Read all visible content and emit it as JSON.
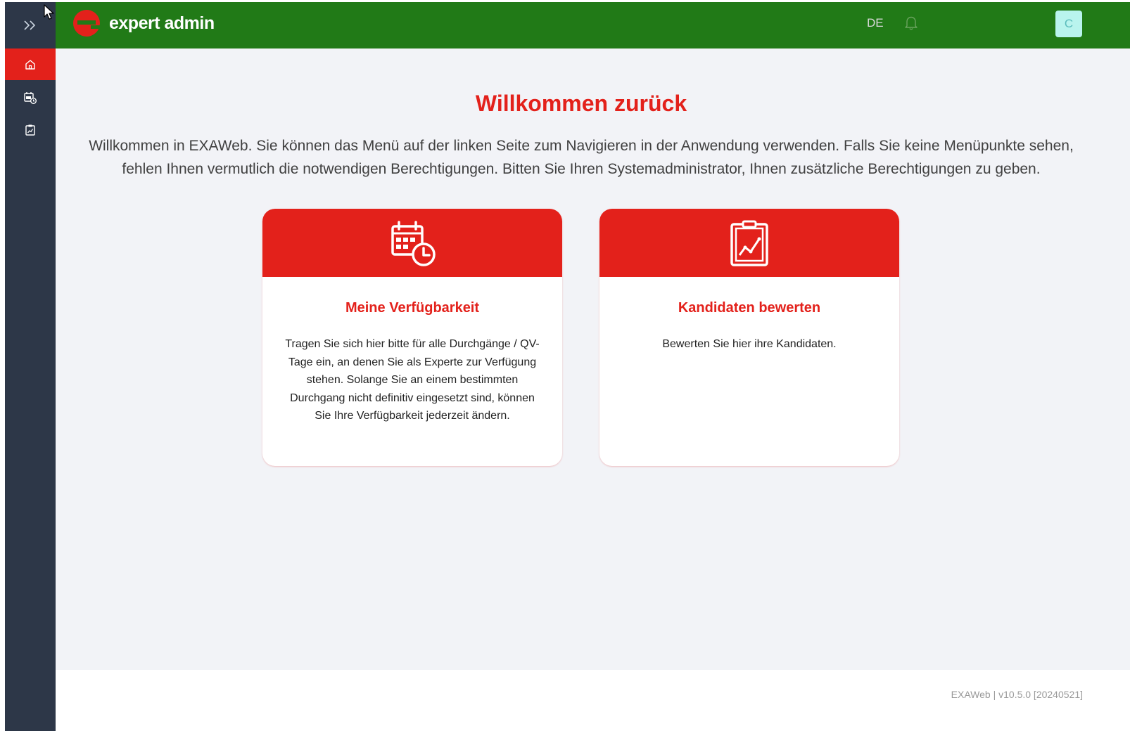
{
  "brand": {
    "name": "expert admin",
    "logo_letter": "e"
  },
  "header": {
    "language": "DE",
    "avatar_initial": "C"
  },
  "sidebar": {
    "items": [
      {
        "id": "home",
        "icon": "home-icon",
        "active": true
      },
      {
        "id": "availability",
        "icon": "calendar-clock-icon",
        "active": false
      },
      {
        "id": "evaluate",
        "icon": "clipboard-chart-icon",
        "active": false
      }
    ]
  },
  "main": {
    "title": "Willkommen zurück",
    "intro": "Willkommen in EXAWeb. Sie können das Menü auf der linken Seite zum Navigieren in der Anwendung verwenden. Falls Sie keine Menüpunkte sehen, fehlen Ihnen vermutlich die notwendigen Berechtigungen. Bitten Sie Ihren Systemadministrator, Ihnen zusätzliche Berechtigungen zu geben.",
    "cards": [
      {
        "icon": "calendar-clock-icon",
        "title": "Meine Verfügbarkeit",
        "description": "Tragen Sie sich hier bitte für alle Durchgänge / QV-Tage ein, an denen Sie als Experte zur Verfügung stehen. Solange Sie an einem bestimmten Durchgang nicht definitiv eingesetzt sind, können Sie Ihre Verfügbarkeit jederzeit ändern."
      },
      {
        "icon": "clipboard-chart-icon",
        "title": "Kandidaten bewerten",
        "description": "Bewerten Sie hier ihre Kandidaten."
      }
    ]
  },
  "footer": {
    "version": "EXAWeb | v10.5.0 [20240521]"
  },
  "colors": {
    "brand_red": "#e3211b",
    "header_green": "#217a17",
    "sidebar_dark": "#2d3748"
  }
}
